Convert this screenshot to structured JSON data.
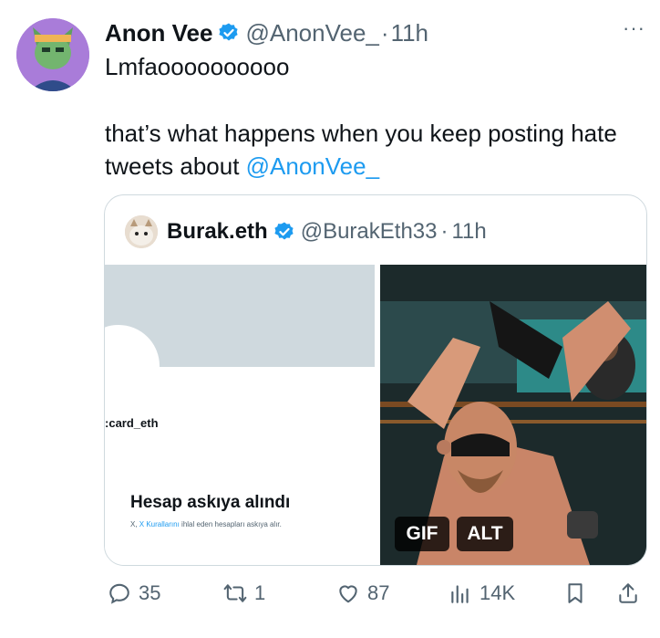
{
  "tweet": {
    "author_name": "Anon Vee",
    "handle": "@AnonVee_",
    "separator": "·",
    "time": "11h",
    "more_label": "···",
    "line1": "Lmfaoooooooooo",
    "body_text": "that’s what happens when you keep posting hate tweets about ",
    "body_mention": "@AnonVee_"
  },
  "quoted": {
    "author_name": "Burak.eth",
    "handle": "@BurakEth33",
    "separator": "·",
    "time": "11h",
    "card_name": "card_eth",
    "card_name_prefix": ":",
    "suspended_title": "Hesap askıya alındı",
    "suspended_text_a": "X, ",
    "suspended_link": "X Kurallarını",
    "suspended_text_b": " ihlal eden hesapları askıya alır.",
    "gif_label": "GIF",
    "alt_label": "ALT"
  },
  "actions": {
    "replies": "35",
    "reposts": "1",
    "likes": "87",
    "views": "14K"
  },
  "colors": {
    "accent": "#1d9bf0",
    "text": "#0f1419",
    "muted": "#536471",
    "border": "#cfd9de"
  },
  "icons": [
    "verified-badge-icon",
    "more-icon",
    "reply-icon",
    "repost-icon",
    "like-icon",
    "views-icon",
    "bookmark-icon",
    "share-icon"
  ]
}
